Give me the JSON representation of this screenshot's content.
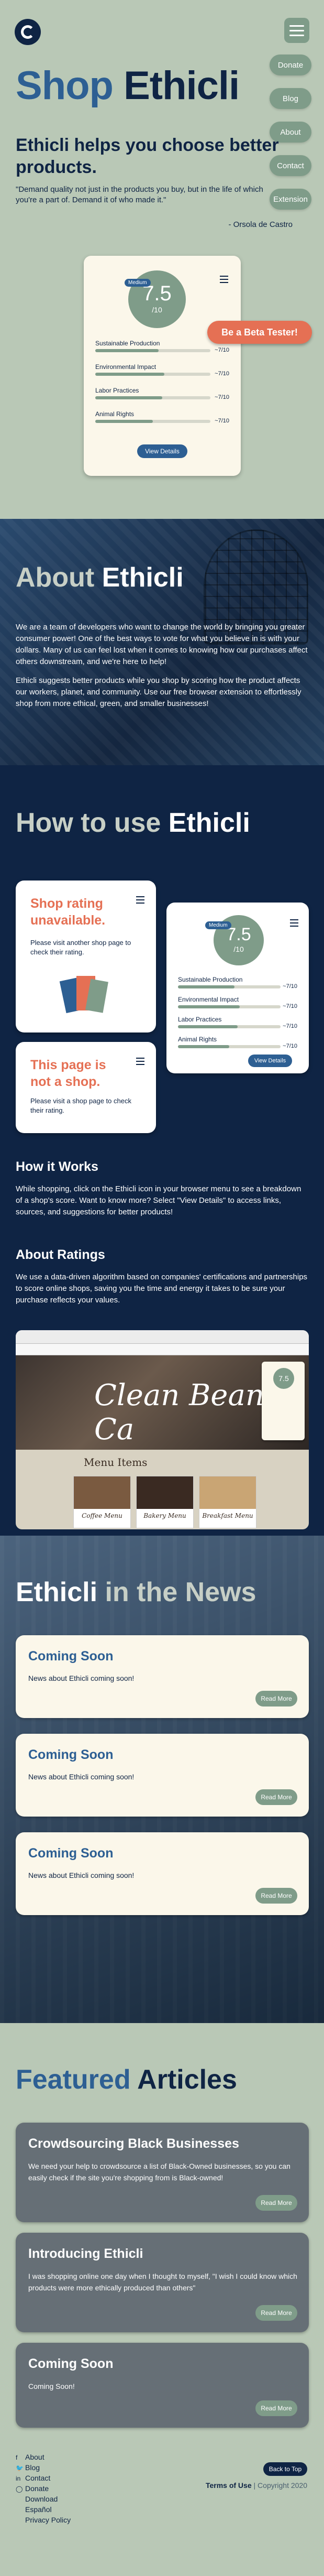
{
  "nav": {
    "items": [
      "Donate",
      "Blog",
      "About",
      "Contact",
      "Extension"
    ]
  },
  "hero": {
    "title_a": "Shop",
    "title_b": "Ethicli",
    "subtitle": "Ethicli helps you choose better products.",
    "quote": "\"Demand quality not just in the products you buy, but in the life of which you're a part of. Demand it of who made it.\"",
    "quote_author": "- Orsola de Castro",
    "beta_button": "Be a Beta Tester!"
  },
  "card": {
    "badge": "Medium",
    "score": "7.5",
    "denom": "/10",
    "metrics": [
      {
        "label": "Sustainable Production",
        "value": "~7/10",
        "level": 0.55
      },
      {
        "label": "Environmental Impact",
        "value": "~7/10",
        "level": 0.6
      },
      {
        "label": "Labor Practices",
        "value": "~7/10",
        "level": 0.58
      },
      {
        "label": "Animal Rights",
        "value": "~7/10",
        "level": 0.5
      }
    ],
    "button": "View Details"
  },
  "about": {
    "title_a": "About",
    "title_b": "Ethicli",
    "p1": "We are a team of developers who want to change the world by bringing you greater consumer power! One of the best ways to vote for what you believe in is with your dollars. Many of us can feel lost when it comes to knowing how our purchases affect others downstream, and we're here to help!",
    "p2": "Ethicli suggests better products while you shop by scoring how the product affects our workers, planet, and community. Use our free browser extension to effortlessly shop from more ethical, green, and smaller businesses!"
  },
  "howto": {
    "title_a": "How to use",
    "title_b": "Ethicli",
    "card1": {
      "title": "Shop rating unavailable.",
      "desc": "Please visit another shop page to check their rating."
    },
    "card2": {
      "title": "This page is not a shop.",
      "desc": "Please visit a shop page to check their rating."
    },
    "how_title": "How it Works",
    "how_text": "While shopping, click on the Ethicli icon in your browser menu to see a breakdown of a shop's score. Want to know more? Select \"View Details\" to access links, sources, and suggestions for better products!",
    "ratings_title": "About Ratings",
    "ratings_text": "We use a data-driven algorithm based on companies' certifications and partnerships to score online shops, saving you the time and energy it takes to be sure your purchase reflects your values.",
    "shot": {
      "banner": "Clean Bean Ca",
      "menu": "Menu Items",
      "items": [
        "Coffee Menu",
        "Bakery Menu",
        "Breakfast Menu"
      ]
    }
  },
  "news": {
    "title_a": "Ethicli",
    "title_b": "in the News",
    "cards": [
      {
        "title": "Coming Soon",
        "desc": "News about Ethicli coming soon!",
        "button": "Read More"
      },
      {
        "title": "Coming Soon",
        "desc": "News about Ethicli coming soon!",
        "button": "Read More"
      },
      {
        "title": "Coming Soon",
        "desc": "News about Ethicli coming soon!",
        "button": "Read More"
      }
    ]
  },
  "featured": {
    "title_a": "Featured",
    "title_b": "Articles",
    "cards": [
      {
        "title": "Crowdsourcing Black Businesses",
        "desc": "We need your help to crowdsource a list of Black-Owned businesses, so you can easily check if the site you're shopping from is Black-owned!",
        "button": "Read More"
      },
      {
        "title": "Introducing Ethicli",
        "desc": "I was shopping online one day when I thought to myself, \"I wish I could know which products were more ethically produced than others\"",
        "button": "Read More"
      },
      {
        "title": "Coming Soon",
        "desc": "Coming Soon!",
        "button": "Read More"
      }
    ]
  },
  "footer": {
    "links": [
      "About",
      "Blog",
      "Contact",
      "Donate",
      "Download",
      "Español",
      "Privacy Policy"
    ],
    "icons": [
      "facebook-icon",
      "twitter-icon",
      "linkedin-icon",
      "instagram-icon",
      "download-icon",
      "translate-icon",
      "privacy-icon"
    ],
    "back_to_top": "Back to Top",
    "terms": "Terms of Use",
    "copyright": "| Copyright 2020"
  }
}
